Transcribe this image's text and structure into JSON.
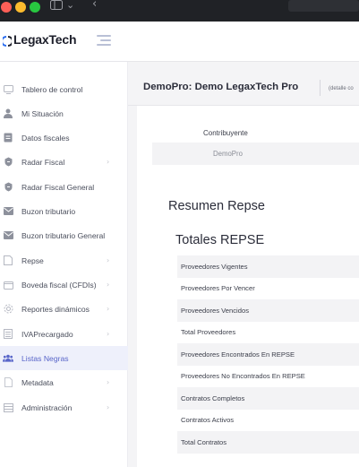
{
  "app": {
    "brand": "LegaxTech"
  },
  "sidebar": {
    "items": [
      {
        "label": "Tablero de control",
        "icon": "monitor-icon",
        "chevron": false,
        "active": false
      },
      {
        "label": "Mi Situación",
        "icon": "user-icon",
        "chevron": false,
        "active": false
      },
      {
        "label": "Datos fiscales",
        "icon": "file-icon",
        "chevron": false,
        "active": false
      },
      {
        "label": "Radar Fiscal",
        "icon": "radar-icon",
        "chevron": true,
        "active": false
      },
      {
        "label": "Radar Fiscal General",
        "icon": "radar-icon",
        "chevron": false,
        "active": false
      },
      {
        "label": "Buzon tributario",
        "icon": "mail-icon",
        "chevron": false,
        "active": false
      },
      {
        "label": "Buzon tributario General",
        "icon": "mail-icon",
        "chevron": false,
        "active": false
      },
      {
        "label": "Repse",
        "icon": "document-icon",
        "chevron": true,
        "active": false
      },
      {
        "label": "Boveda fiscal (CFDIs)",
        "icon": "vault-icon",
        "chevron": true,
        "active": false
      },
      {
        "label": "Reportes dinámicos",
        "icon": "gear-icon",
        "chevron": true,
        "active": false
      },
      {
        "label": "IVAPrecargado",
        "icon": "list-icon",
        "chevron": true,
        "active": false
      },
      {
        "label": "Listas Negras",
        "icon": "users-icon",
        "chevron": false,
        "active": true
      },
      {
        "label": "Metadata",
        "icon": "page-icon",
        "chevron": true,
        "active": false
      },
      {
        "label": "Administración",
        "icon": "table-icon",
        "chevron": true,
        "active": false
      }
    ]
  },
  "main": {
    "title": "DemoPro: Demo LegaxTech Pro",
    "detail": "(detalle co",
    "contribuyente_label": "Contribuyente",
    "contribuyente_value": "DemoPro",
    "resumen_heading": "Resumen Repse",
    "totales_heading": "Totales REPSE",
    "rows": [
      "Proveedores Vigentes",
      "Proveedores Por Vencer",
      "Proveedores Vencidos",
      "Total Proveedores",
      "Proveedores Encontrados En REPSE",
      "Proveedores No Encontrados En REPSE",
      "Contratos Completos",
      "Contratos Activos",
      "Total Contratos"
    ]
  },
  "colors": {
    "accent": "#5865c9",
    "active_bg": "#eef0fb",
    "titlebar": "#202226",
    "row_shade": "#f3f3f5"
  }
}
